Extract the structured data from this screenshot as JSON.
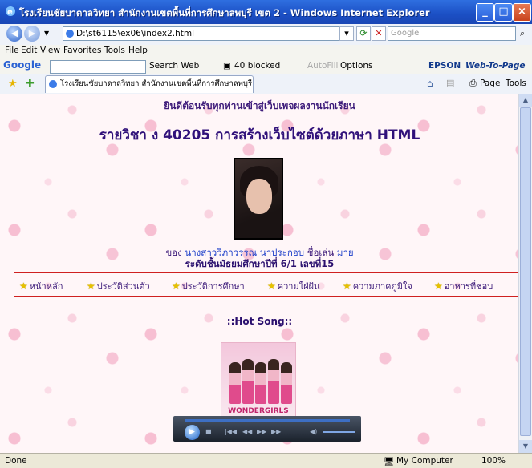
{
  "window": {
    "title": "โรงเรียนชัยบาดาลวิทยา สำนักงานเขตพื้นที่การศึกษาลพบุรี เขต 2 - Windows Internet Explorer",
    "minimize": "_",
    "maximize": "□",
    "close": "×"
  },
  "address": {
    "url": "D:\\st6115\\ex06\\index2.html",
    "search_placeholder": "Google"
  },
  "menu": [
    "File",
    "Edit",
    "View",
    "Favorites",
    "Tools",
    "Help"
  ],
  "google_toolbar": {
    "logo": "Google",
    "search_web": "Search Web",
    "blocked": "40 blocked",
    "autofill": "AutoFill",
    "options": "Options",
    "epson": "EPSON",
    "web_to_page": "Web-To-Page"
  },
  "tabbar": {
    "tab_title": "โรงเรียนชัยบาดาลวิทยา สำนักงานเขตพื้นที่การศึกษาลพบุรี...",
    "page": "Page",
    "tools": "Tools"
  },
  "page": {
    "welcome": "ยินดีต้อนรับทุกท่านเข้าสู่เว็บเพจผลงานนักเรียน",
    "heading": "รายวิชา ง 40205 การสร้างเว็บไซต์ด้วยภาษา HTML",
    "owner_prefix": "ของ",
    "owner_name": "นางสาววิภาวรรณ นาประกอบ",
    "nickname_label": "ชื่อเล่น",
    "nickname": "มาย",
    "grade": "ระดับชั้นมัธยมศึกษาปีที่ 6/1 เลขที่15",
    "nav": [
      "หน้าหลัก",
      "ประวัติส่วนตัว",
      "ประวัติการศึกษา",
      "ความใฝ่ฝัน",
      "ความภาคภูมิใจ",
      "อาหารที่ชอบ"
    ],
    "hot_song": "::Hot Song::",
    "album_logo": "WONDERGIRLS"
  },
  "status": {
    "left": "Done",
    "zone": "My Computer",
    "zoom": "100%"
  },
  "colors": {
    "accent": "#2f6fe0",
    "heading": "#30117a",
    "rule": "#cf2020"
  }
}
